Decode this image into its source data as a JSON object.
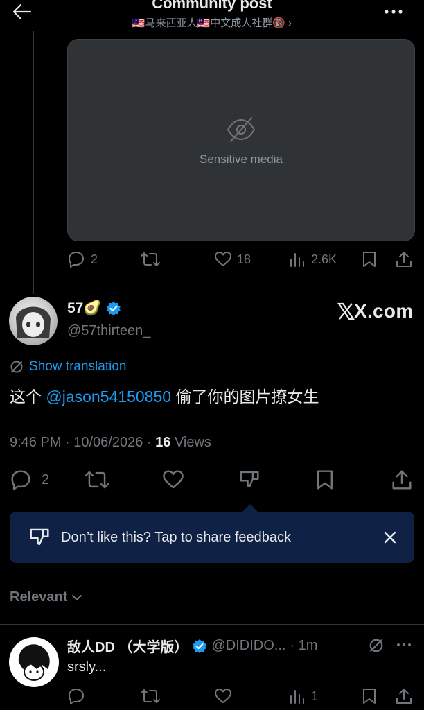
{
  "header": {
    "title": "Community post",
    "community": "🇲🇾马来西亚人🇲🇾中文成人社群🔞",
    "chevron": "›",
    "back_icon": "arrow-left-icon",
    "more_icon": "more-icon"
  },
  "parent_post": {
    "media_notice": "Sensitive media",
    "actions": {
      "replies": "2",
      "likes": "18",
      "views": "2.6K"
    }
  },
  "main_post": {
    "display_name": "57🥑",
    "handle": "@57thirteen_",
    "brand": "X.com",
    "show_translation": "Show translation",
    "text_before": "这个 ",
    "mention": "@jason54150850",
    "text_after": " 偷了你的图片撩女生",
    "time": "9:46 PM · 10/06/2026 · ",
    "views_count": "16",
    "views_label": " Views",
    "actions": {
      "replies": "2"
    }
  },
  "feedback_banner": {
    "text": "Don’t like this? Tap to share feedback"
  },
  "sort": {
    "label": "Relevant"
  },
  "reply": {
    "display_name": "敌人DD （大学版）",
    "handle": "@DIDIDO...",
    "time": "· 1m",
    "text": "srsly...",
    "actions": {
      "views": "1"
    }
  },
  "colors": {
    "background": "#000000",
    "text": "#e7e9ea",
    "muted": "#71767b",
    "accent": "#1d9bf0",
    "banner": "#0f2246"
  }
}
